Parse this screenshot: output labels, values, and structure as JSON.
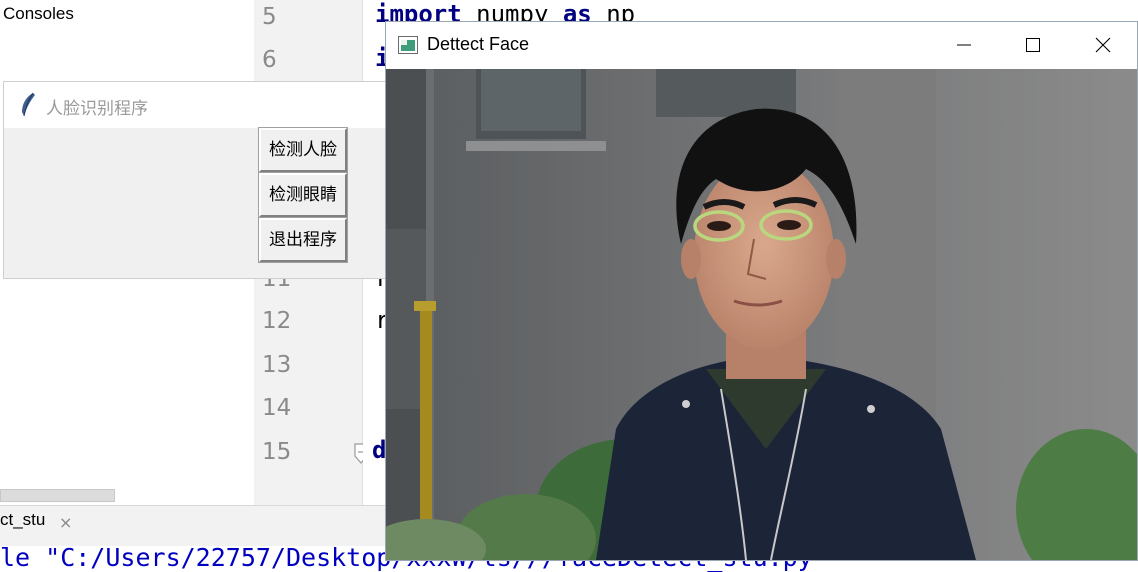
{
  "ide": {
    "consoles_label": "Consoles",
    "line_numbers": [
      "5",
      "6",
      "11",
      "12",
      "13",
      "14",
      "15"
    ],
    "code": {
      "line5_kw1": "import",
      "line5_mid": " numpy ",
      "line5_kw2": "as",
      "line5_tail": " np",
      "line6_partial": "i",
      "line11_partial": "r",
      "line12_partial": "r",
      "line15_partial": "d"
    },
    "bottom_tab": {
      "label": "ct_stu",
      "close_glyph": "×"
    },
    "console_output": "le \"C:/Users/22757/Desktop/xxxW/ts///faceDetect_stu.py"
  },
  "tk_window": {
    "title": "人脸识别程序",
    "buttons": {
      "detect_face": "检测人脸",
      "detect_eyes": "检测眼睛",
      "exit": "退出程序"
    }
  },
  "cv_window": {
    "title": "Dettect Face",
    "controls": {
      "minimize": "minimize-icon",
      "maximize": "maximize-icon",
      "close": "close-icon"
    },
    "eye_marker_color": "#b9d77e"
  }
}
